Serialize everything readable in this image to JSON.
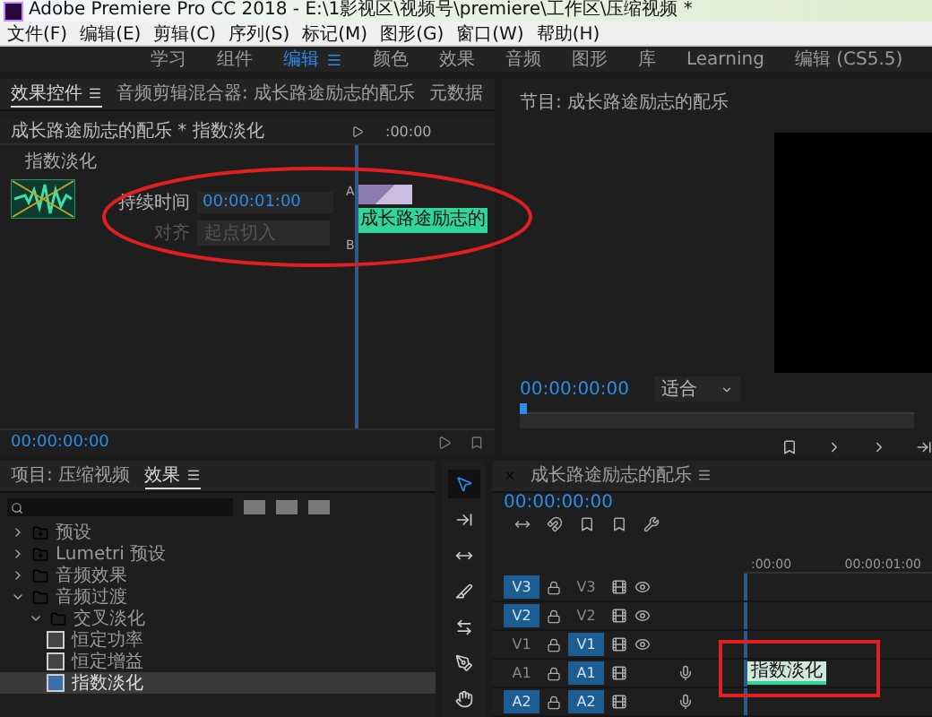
{
  "window": {
    "title": "Adobe Premiere Pro CC 2018 - E:\\1影视区\\视频号\\premiere\\工作区\\压缩视频 *"
  },
  "menu": [
    "文件(F)",
    "编辑(E)",
    "剪辑(C)",
    "序列(S)",
    "标记(M)",
    "图形(G)",
    "窗口(W)",
    "帮助(H)"
  ],
  "workspaces": [
    {
      "label": "学习",
      "selected": false
    },
    {
      "label": "组件",
      "selected": false
    },
    {
      "label": "编辑",
      "selected": true
    },
    {
      "label": "颜色",
      "selected": false
    },
    {
      "label": "效果",
      "selected": false
    },
    {
      "label": "音频",
      "selected": false
    },
    {
      "label": "图形",
      "selected": false
    },
    {
      "label": "库",
      "selected": false
    },
    {
      "label": "Learning",
      "selected": false
    },
    {
      "label": "编辑 (CS5.5)",
      "selected": false
    }
  ],
  "effect_controls": {
    "tabs": [
      {
        "label": "效果控件",
        "selected": true
      },
      {
        "label": "音频剪辑混合器: 成长路途励志的配乐",
        "selected": false
      },
      {
        "label": "元数据",
        "selected": false
      }
    ],
    "clip_path": "成长路途励志的配乐 * 指数淡化",
    "ruler": ":00:00",
    "effect_name": "指数淡化",
    "duration_label": "持续时间",
    "duration": "00:00:01:00",
    "align_label": "对齐",
    "align_value": "起点切入",
    "align_disabled": true,
    "track_a": "A",
    "track_b": "B",
    "clip_label": "成长路途励志的",
    "timecode": "00:00:00:00"
  },
  "program": {
    "title": "节目: 成长路途励志的配乐",
    "timecode": "00:00:00:00",
    "zoom": "适合"
  },
  "project": {
    "tabs": [
      {
        "label": "项目: 压缩视频",
        "selected": false
      },
      {
        "label": "效果",
        "selected": true
      }
    ],
    "tree": [
      {
        "label": "预设",
        "kind": "preset",
        "expanded": false,
        "selected": false
      },
      {
        "label": "Lumetri 预设",
        "kind": "preset",
        "expanded": false,
        "selected": false
      },
      {
        "label": "音频效果",
        "kind": "folder",
        "expanded": false,
        "selected": false
      },
      {
        "label": "音频过渡",
        "kind": "folder",
        "expanded": true,
        "selected": false,
        "children": [
          {
            "label": "交叉淡化",
            "kind": "folder",
            "expanded": true,
            "selected": false,
            "children": [
              {
                "label": "恒定功率",
                "kind": "effect",
                "selected": false
              },
              {
                "label": "恒定增益",
                "kind": "effect",
                "selected": false
              },
              {
                "label": "指数淡化",
                "kind": "effect",
                "selected": true
              }
            ]
          }
        ]
      }
    ]
  },
  "tools": [
    {
      "kind": "select",
      "selected": true
    },
    {
      "kind": "track",
      "selected": false
    },
    {
      "kind": "ripple",
      "selected": false
    },
    {
      "kind": "razor",
      "selected": false
    },
    {
      "kind": "slip",
      "selected": false
    },
    {
      "kind": "pen",
      "selected": false
    },
    {
      "kind": "hand",
      "selected": false
    }
  ],
  "timeline": {
    "title": "成长路途励志的配乐",
    "timecode": "00:00:00:00",
    "ruler": [
      ":00:00",
      "00:00:01:00"
    ],
    "tracks": [
      {
        "kind": "video",
        "source": "V3",
        "source_targeted": true,
        "name": "V3",
        "targeted": false
      },
      {
        "kind": "video",
        "source": "V2",
        "source_targeted": true,
        "name": "V2",
        "targeted": false
      },
      {
        "kind": "video",
        "source": "V1",
        "source_targeted": false,
        "name": "V1",
        "targeted": true
      },
      {
        "kind": "audio",
        "source": "A1",
        "source_targeted": false,
        "name": "A1",
        "targeted": true,
        "clip": "指数淡化"
      },
      {
        "kind": "audio",
        "source": "A2",
        "source_targeted": true,
        "name": "A2",
        "targeted": true
      }
    ]
  }
}
